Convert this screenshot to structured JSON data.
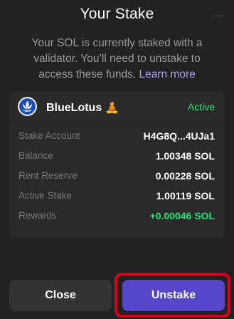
{
  "header": {
    "title": "Your Stake",
    "menu_glyph": "···"
  },
  "description": {
    "text": "Your SOL is currently staked with a validator. You’ll need to unstake to access these funds.",
    "link_label": "Learn more"
  },
  "validator": {
    "name": "BlueLotus 🧘",
    "status": "Active",
    "logo_icon": "lotus-logo-icon",
    "status_color": "#21e56f"
  },
  "details": [
    {
      "label": "Stake Account",
      "value": "H4G8Q...4UJa1"
    },
    {
      "label": "Balance",
      "value": "1.00348 SOL"
    },
    {
      "label": "Rent Reserve",
      "value": "0.00228 SOL"
    },
    {
      "label": "Active Stake",
      "value": "1.00119 SOL"
    },
    {
      "label": "Rewards",
      "value": "+0.00046 SOL"
    }
  ],
  "actions": {
    "close_label": "Close",
    "unstake_label": "Unstake"
  },
  "colors": {
    "background": "#222222",
    "card": "#2a2a2a",
    "accent": "#5545c8",
    "link": "#ab9ff2",
    "positive": "#21e56f",
    "highlight": "#d9001b"
  }
}
